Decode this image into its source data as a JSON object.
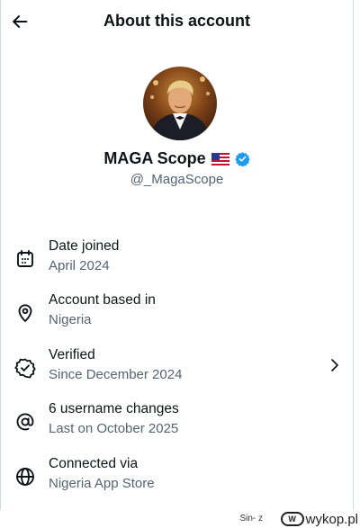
{
  "header": {
    "title": "About this account"
  },
  "profile": {
    "display_name": "MAGA Scope",
    "handle": "@_MagaScope",
    "flag_icon": "us-flag-icon",
    "verified_color": "#1d9bf0"
  },
  "details": [
    {
      "icon": "calendar-icon",
      "title": "Date joined",
      "subtitle": "April 2024"
    },
    {
      "icon": "location-pin-icon",
      "title": "Account based in",
      "subtitle": "Nigeria"
    },
    {
      "icon": "verified-badge-outline-icon",
      "title": "Verified",
      "subtitle": "Since December 2024",
      "has_chevron": true
    },
    {
      "icon": "at-sign-icon",
      "title": "6 username changes",
      "subtitle": "Last on October 2025"
    },
    {
      "icon": "globe-icon",
      "title": "Connected via",
      "subtitle": "Nigeria App Store"
    }
  ],
  "footer": {
    "credit": "Sin-  z",
    "site": "wykop.pl"
  }
}
